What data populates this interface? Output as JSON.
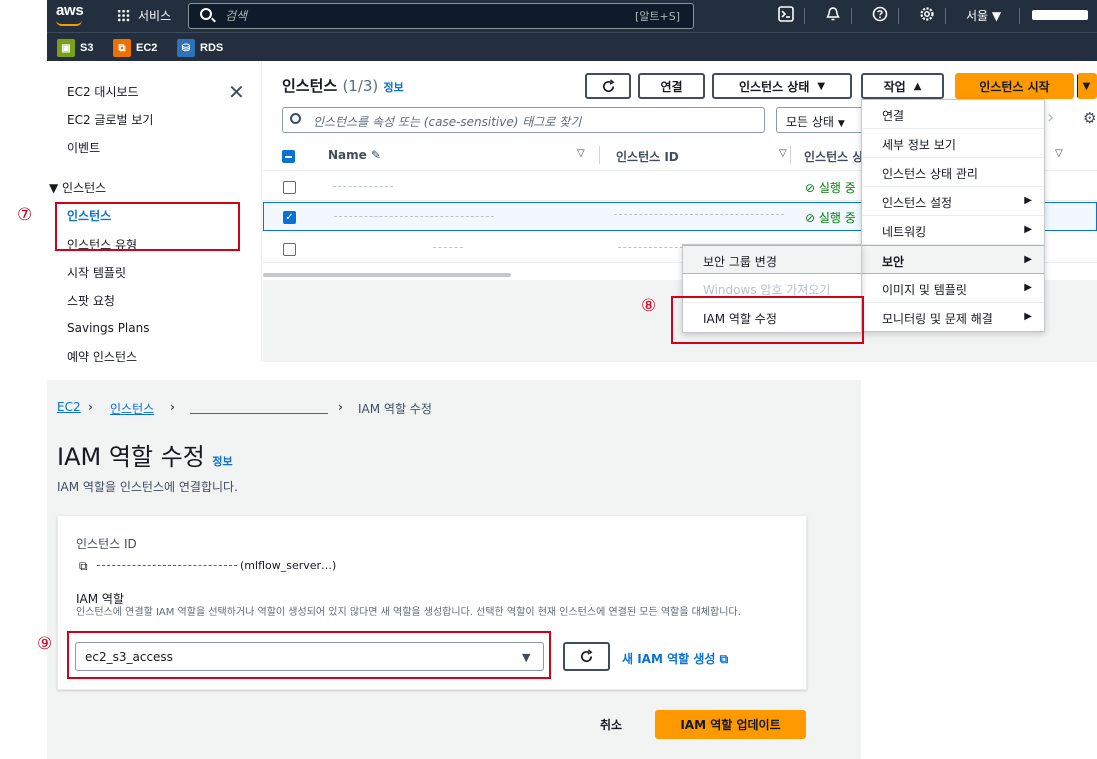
{
  "topnav": {
    "logo": "aws",
    "services_label": "서비스",
    "search_placeholder": "검색",
    "search_shortcut": "[알트+S]",
    "region": "서울 ▼"
  },
  "favorites": [
    {
      "label": "S3",
      "color": "#7aa116"
    },
    {
      "label": "EC2",
      "color": "#ed7100"
    },
    {
      "label": "RDS",
      "color": "#2e73b8"
    }
  ],
  "sidebar": {
    "items": [
      "EC2 대시보드",
      "EC2 글로벌 보기",
      "이벤트"
    ],
    "section": "▼ 인스턴스",
    "sub_items": [
      "인스턴스",
      "인스턴스 유형",
      "시작 템플릿",
      "스팟 요청",
      "Savings Plans",
      "예약 인스턴스"
    ]
  },
  "instances": {
    "title": "인스턴스",
    "count": "(1/3)",
    "info": "정보",
    "btn_connect": "연결",
    "btn_state": "인스턴스 상태",
    "btn_actions": "작업",
    "btn_launch": "인스턴스 시작",
    "filter_placeholder": "인스턴스를 속성 또는 (case-sensitive) 태그로 찾기",
    "state_filter": "모든 상태",
    "columns": [
      "Name",
      "인스턴스 ID",
      "인스턴스 상"
    ],
    "rows": [
      {
        "status": "실행 중",
        "selected": false
      },
      {
        "status": "실행 중",
        "selected": true
      },
      {
        "status": "",
        "selected": false
      }
    ]
  },
  "actions_menu": [
    "연결",
    "세부 정보 보기",
    "인스턴스 상태 관리",
    "인스턴스 설정",
    "네트워킹",
    "보안",
    "이미지 및 템플릿",
    "모니터링 및 문제 해결"
  ],
  "security_submenu": [
    "보안 그룹 변경",
    "Windows 암호 가져오기",
    "IAM 역할 수정"
  ],
  "callouts": [
    "⑦",
    "⑧",
    "⑨"
  ],
  "form": {
    "breadcrumb": [
      "EC2",
      "인스턴스",
      "IAM 역할 수정"
    ],
    "title": "IAM 역할 수정",
    "info": "정보",
    "subtitle": "IAM 역할을 인스턴스에 연결합니다.",
    "instance_id_label": "인스턴스 ID",
    "instance_id_suffix": "(mlflow_server…)",
    "role_label": "IAM 역할",
    "role_desc": "인스턴스에 연결할 IAM 역할을 선택하거나 역할이 생성되어 있지 않다면 새 역할을 생성합니다. 선택한 역할이 현재 인스턴스에 연결된 모든 역할을 대체합니다.",
    "role_value": "ec2_s3_access",
    "new_role_link": "새 IAM 역할 생성",
    "cancel": "취소",
    "submit": "IAM 역할 업데이트"
  }
}
